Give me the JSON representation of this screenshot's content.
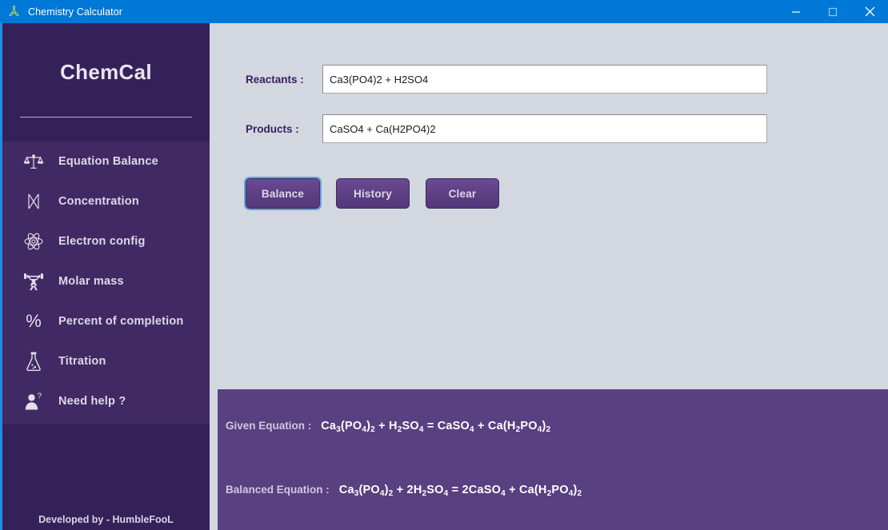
{
  "window": {
    "title": "Chemistry Calculator",
    "icon": "biohazard-icon",
    "accent_color": "#0078d7",
    "controls": {
      "minimize": "minimize-icon",
      "maximize": "maximize-icon",
      "close": "close-icon"
    }
  },
  "sidebar": {
    "brand": "ChemCal",
    "background_color": "#35215a",
    "menu_background_color": "#412a63",
    "items": [
      {
        "label": "Equation Balance",
        "icon": "balance-scale-icon"
      },
      {
        "label": "Concentration",
        "icon": "concentration-icon"
      },
      {
        "label": "Electron config",
        "icon": "atom-icon"
      },
      {
        "label": "Molar mass",
        "icon": "weightlifter-icon"
      },
      {
        "label": "Percent of completion",
        "icon": "percent-icon"
      },
      {
        "label": "Titration",
        "icon": "flask-icon"
      },
      {
        "label": "Need help ?",
        "icon": "person-question-icon"
      }
    ],
    "footer": "Developed by - HumbleFooL"
  },
  "form": {
    "reactants": {
      "label": "Reactants :",
      "value": "Ca3(PO4)2 + H2SO4",
      "placeholder": ""
    },
    "products": {
      "label": "Products  :",
      "value": "CaSO4 + Ca(H2PO4)2",
      "placeholder": ""
    }
  },
  "buttons": {
    "balance": "Balance",
    "history": "History",
    "clear": "Clear",
    "focused": "Balance",
    "color": "#5d3f84"
  },
  "result": {
    "background_color": "#594081",
    "given_label": "Given Equation :",
    "given_equation_plain": "Ca3(PO4)2 + H2SO4 = CaSO4 + Ca(H2PO4)2",
    "given_equation_html": "Ca<sub>3</sub>(PO<sub>4</sub>)<sub>2</sub> + H<sub>2</sub>SO<sub>4</sub> = CaSO<sub>4</sub> + Ca(H<sub>2</sub>PO<sub>4</sub>)<sub>2</sub>",
    "balanced_label": "Balanced Equation :",
    "balanced_equation_plain": "Ca3(PO4)2 + 2H2SO4 = 2CaSO4 + Ca(H2PO4)2",
    "balanced_equation_html": "Ca<sub>3</sub>(PO<sub>4</sub>)<sub>2</sub> + 2H<sub>2</sub>SO<sub>4</sub> = 2CaSO<sub>4</sub> + Ca(H<sub>2</sub>PO<sub>4</sub>)<sub>2</sub>"
  }
}
